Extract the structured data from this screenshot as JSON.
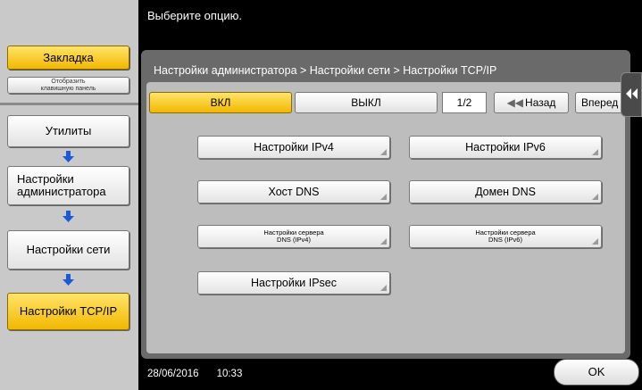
{
  "header": {
    "message": "Выберите опцию."
  },
  "sidebar": {
    "bookmark_label": "Закладка",
    "keypad_label_line1": "Отобразить",
    "keypad_label_line2": "клавишную панель",
    "nav": [
      {
        "label": "Утилиты"
      },
      {
        "label_line1": "Настройки",
        "label_line2": "администратора"
      },
      {
        "label": "Настройки сети"
      },
      {
        "label": "Настройки TCP/IP",
        "active": true
      }
    ]
  },
  "main": {
    "breadcrumb": "Настройки администратора > Настройки сети > Настройки TCP/IP",
    "toggle": {
      "on_label": "ВКЛ",
      "off_label": "ВЫКЛ",
      "selected": "ВКЛ"
    },
    "page_indicator": "1/2",
    "back_label": "Назад",
    "forward_label": "Вперед",
    "options": [
      {
        "label": "Настройки IPv4"
      },
      {
        "label": "Настройки IPv6"
      },
      {
        "label": "Хост DNS"
      },
      {
        "label": "Домен DNS"
      },
      {
        "line1": "Настройки сервера",
        "line2": "DNS (IPv4)"
      },
      {
        "line1": "Настройки сервера",
        "line2": "DNS (IPv6)"
      },
      {
        "label": "Настройки IPsec"
      }
    ]
  },
  "footer": {
    "date": "28/06/2016",
    "time": "10:33",
    "ok_label": "OK"
  },
  "colors": {
    "accent": "#f2b800",
    "arrow": "#1a5ad6",
    "panel": "#6a6a6a"
  }
}
